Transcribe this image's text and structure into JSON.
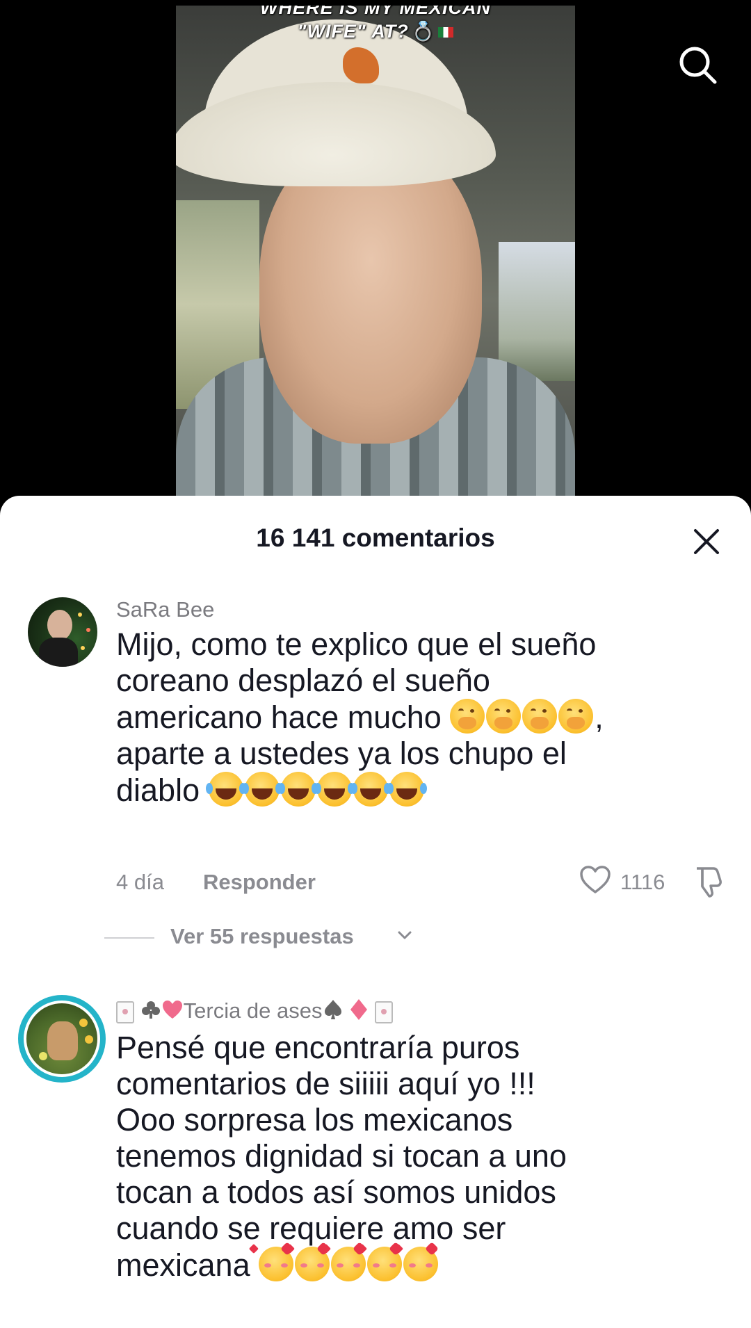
{
  "video": {
    "caption_line1": "WHERE IS MY MEXICAN",
    "caption_line2": "\"WIFE\" AT?"
  },
  "header": {
    "search_icon": "search-icon"
  },
  "comments_sheet": {
    "title": "16 141 comentarios",
    "close_icon": "close-icon",
    "comments": [
      {
        "username": "SaRa Bee",
        "text_lines": [
          "Mijo, como te explico que el sueño",
          "coreano desplazó el sueño",
          "americano hace mucho",
          ",",
          "aparte a ustedes ya los chupo el",
          "diablo"
        ],
        "emojis_after_line3": "hand-over-mouth x4",
        "emojis_after_line6": "tears-of-joy x6",
        "age": "4 día",
        "reply_label": "Responder",
        "like_count": "1116",
        "view_replies": "Ver 55 respuestas"
      },
      {
        "username_prefix_icons": [
          "card-icon",
          "club-icon",
          "heart-icon"
        ],
        "username": "Tercia de ases",
        "username_suffix_icons": [
          "spade-icon",
          "diamond-icon",
          "card-icon"
        ],
        "text_lines": [
          "Pensé que encontraría puros",
          "comentarios de siiiii aquí yo !!!",
          "Ooo sorpresa los mexicanos",
          "tenemos dignidad si tocan a uno",
          "tocan a todos así somos unidos",
          "cuando se requiere amo ser",
          "mexicana"
        ],
        "emojis_after_last_line": "smiling-face-with-hearts x5"
      }
    ]
  },
  "colors": {
    "text_primary": "#161823",
    "text_secondary": "#8a8b91",
    "avatar_ring": "#24b4c9"
  }
}
